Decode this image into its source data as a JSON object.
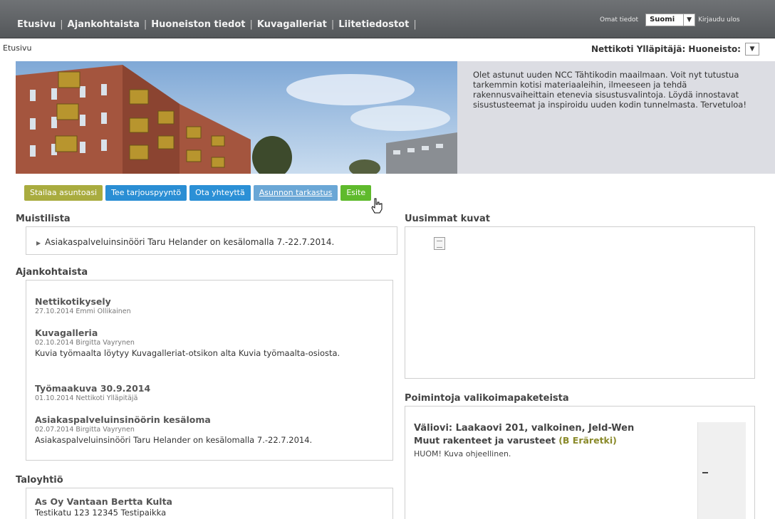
{
  "nav": {
    "items": [
      "Etusivu",
      "Ajankohtaista",
      "Huoneiston tiedot",
      "Kuvagalleriat",
      "Liitetiedostot"
    ]
  },
  "topright": {
    "omat": "Omat tiedot",
    "language": "Suomi",
    "login": "Kirjaudu ulos"
  },
  "breadcrumb": "Etusivu",
  "admin": {
    "label": "Nettikoti Ylläpitäjä: Huoneisto:"
  },
  "hero": {
    "text": "Olet astunut uuden NCC Tähtikodin maailmaan. Voit nyt tutustua tarkemmin kotisi materiaaleihin, ilmeeseen ja tehdä rakennusvaiheittain etenevia sisustusvalintoja. Löydä innostavat sisustusteemat ja inspiroidu uuden kodin tunnelmasta. Tervetuloa!"
  },
  "actions": {
    "stailaa": "Stailaa asuntoasi",
    "tarjous": "Tee tarjouspyyntö",
    "yhteys": "Ota yhteyttä",
    "tarkastus": "Asunnon tarkastus",
    "esite": "Esite"
  },
  "memo": {
    "heading": "Muistilista",
    "item": "Asiakaspalveluinsinööri Taru Helander on kesälomalla 7.-22.7.2014."
  },
  "news": {
    "heading": "Ajankohtaista",
    "items": [
      {
        "title": "Nettikotikysely",
        "meta": "27.10.2014 Emmi Ollikainen",
        "body": ""
      },
      {
        "title": "Kuvagalleria",
        "meta": "02.10.2014 Birgitta Vayrynen",
        "body": "Kuvia työmaalta löytyy Kuvagalleriat-otsikon alta Kuvia työmaalta-osiosta."
      },
      {
        "title": "Työmaakuva 30.9.2014",
        "meta": "01.10.2014 Nettikoti Ylläpitäjä",
        "body": ""
      },
      {
        "title": "Asiakaspalveluinsinöörin kesäloma",
        "meta": "02.07.2014 Birgitta Vayrynen",
        "body": "Asiakaspalveluinsinööri Taru Helander on kesälomalla 7.-22.7.2014."
      }
    ]
  },
  "company": {
    "heading": "Taloyhtiö",
    "name": "As Oy Vantaan Bertta Kulta",
    "address": "Testikatu 123 12345 Testipaikka"
  },
  "photos": {
    "heading": "Uusimmat kuvat"
  },
  "picks": {
    "heading": "Poimintoja valikoimapaketeista",
    "title": "Väliovi: Laakaovi 201, valkoinen, Jeld-Wen",
    "sub_title": "Muut rakenteet ja varusteet",
    "tag": "(B Eräretki)",
    "note": "HUOM! Kuva ohjeellinen."
  },
  "colors": {
    "olive": "#a9ac3f",
    "blue": "#2a8ed4",
    "green": "#5fba2c",
    "topbar": "#5f6265"
  }
}
